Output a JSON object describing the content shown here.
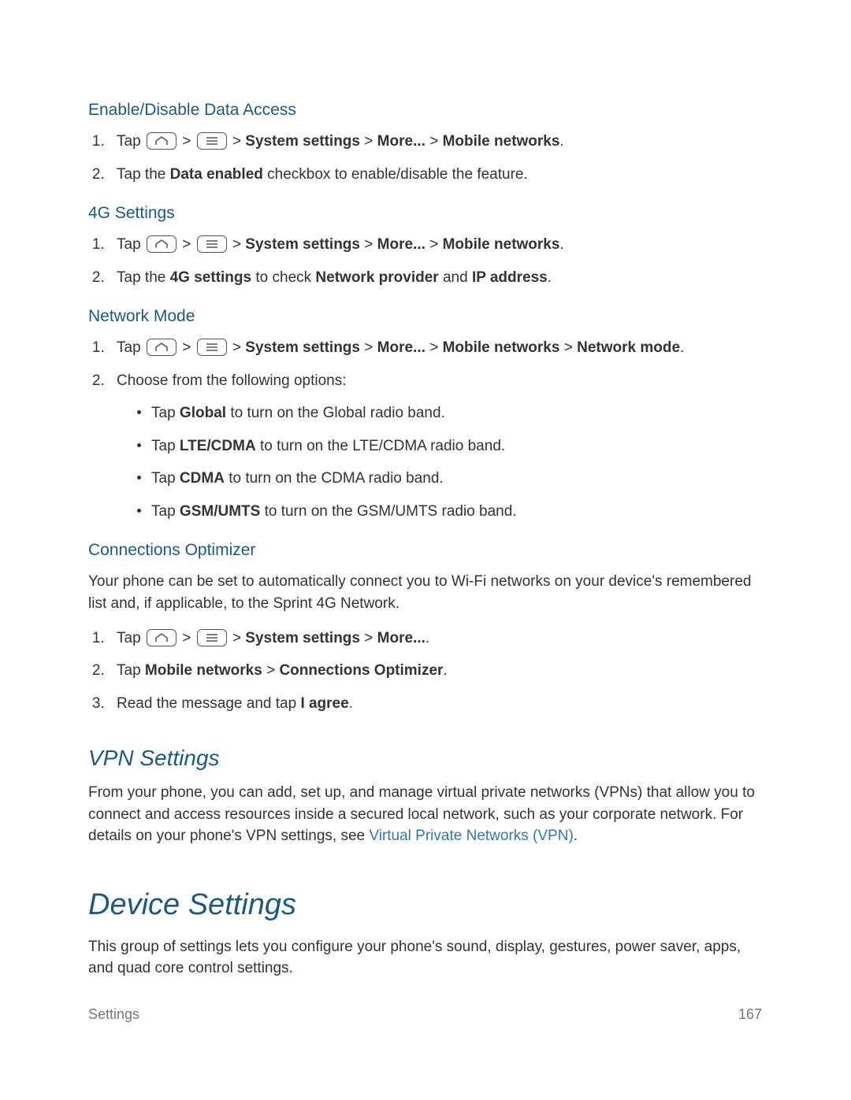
{
  "sections": {
    "dataAccess": {
      "title": "Enable/Disable Data Access",
      "s1": {
        "pre": "Tap ",
        "p1": "System settings",
        "p2": "More...",
        "p3": "Mobile networks",
        "post": "."
      },
      "s2": {
        "a": "Tap the ",
        "b": "Data enabled",
        "c": " checkbox to enable/disable the feature."
      }
    },
    "fourG": {
      "title": "4G Settings",
      "s1": {
        "pre": "Tap ",
        "p1": "System settings",
        "p2": "More...",
        "p3": "Mobile networks",
        "post": "."
      },
      "s2": {
        "a": "Tap the ",
        "b": "4G settings",
        "c": " to check ",
        "d": "Network provider",
        "e": " and ",
        "f": "IP address",
        "g": "."
      }
    },
    "netMode": {
      "title": "Network Mode",
      "s1": {
        "pre": "Tap ",
        "p1": "System settings",
        "p2": "More...",
        "p3": "Mobile networks",
        "p4": "Network mode",
        "post": "."
      },
      "s2": {
        "a": "Choose from the following options:"
      },
      "opt1": {
        "a": "Tap ",
        "b": "Global",
        "c": " to turn on the Global radio band."
      },
      "opt2": {
        "a": "Tap ",
        "b": "LTE/CDMA",
        "c": " to turn on the LTE/CDMA radio band."
      },
      "opt3": {
        "a": "Tap ",
        "b": "CDMA",
        "c": " to turn on the CDMA radio band."
      },
      "opt4": {
        "a": "Tap ",
        "b": "GSM/UMTS",
        "c": " to turn on the GSM/UMTS radio band."
      }
    },
    "connOpt": {
      "title": "Connections Optimizer",
      "intro": "Your phone can be set to automatically connect you to Wi-Fi networks on your device's remembered list and, if applicable, to the Sprint 4G Network.",
      "s1": {
        "pre": "Tap ",
        "p1": "System settings",
        "p2": "More...",
        "post": "."
      },
      "s2": {
        "a": "Tap ",
        "b": "Mobile networks",
        "c": "Connections Optimizer",
        "d": "."
      },
      "s3": {
        "a": "Read the message and tap ",
        "b": "I agree",
        "c": "."
      }
    },
    "vpn": {
      "title": "VPN Settings",
      "intro_a": "From your phone, you can add, set up, and manage virtual private networks (VPNs) that allow you to connect and access resources inside a secured local network, such as your corporate network. For details on your phone's VPN settings, see ",
      "link": "Virtual Private Networks (VPN)",
      "intro_b": "."
    },
    "device": {
      "title": "Device Settings",
      "intro": "This group of settings lets you configure your phone's sound, display, gestures, power saver, apps, and quad core control settings."
    }
  },
  "gt": ">",
  "footer": {
    "left": "Settings",
    "right": "167"
  }
}
